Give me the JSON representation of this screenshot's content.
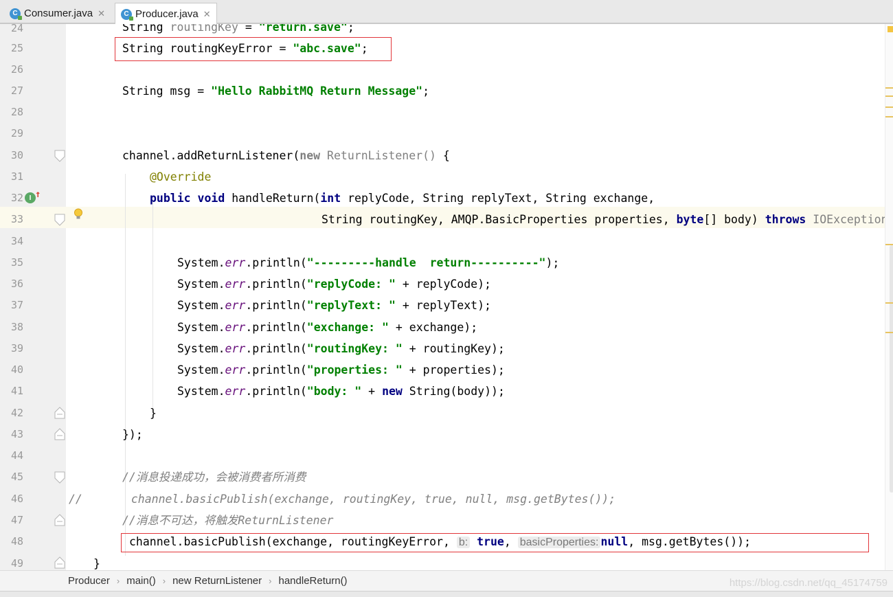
{
  "tabs": [
    {
      "label": "Consumer.java",
      "icon": "java-class-icon",
      "active": false
    },
    {
      "label": "Producer.java",
      "icon": "java-class-icon",
      "active": true
    }
  ],
  "line_numbers": [
    "24",
    "25",
    "26",
    "27",
    "28",
    "29",
    "30",
    "31",
    "32",
    "33",
    "34",
    "35",
    "36",
    "37",
    "38",
    "39",
    "40",
    "41",
    "42",
    "43",
    "44",
    "45",
    "46",
    "47",
    "48",
    "49"
  ],
  "code": {
    "l24": {
      "a": "String ",
      "b": "routingKey",
      "c": " = ",
      "d": "\"return.save\"",
      "e": ";"
    },
    "l25": {
      "a": "String routingKeyError = ",
      "b": "\"abc.save\"",
      "c": ";"
    },
    "l27": {
      "a": "String msg = ",
      "b": "\"Hello RabbitMQ Return Message\"",
      "c": ";"
    },
    "l30": {
      "a": "channel.addReturnListener(",
      "b": "new",
      "c": " ReturnListener() ",
      "d": "{"
    },
    "l31": {
      "a": "@Override"
    },
    "l32": {
      "a": "public",
      "b": " ",
      "c": "void",
      "d": " handleReturn(",
      "e": "int",
      "f": " replyCode, String replyText, String exchange,"
    },
    "l33": {
      "a": "String routingKey, AMQP.BasicProperties properties, ",
      "b": "byte",
      "c": "[] body) ",
      "d": "throws",
      "e": " IOException {"
    },
    "l35": {
      "a": "System.",
      "b": "err",
      "c": ".println(",
      "d": "\"---------handle  return----------\"",
      "e": ");"
    },
    "l36": {
      "a": "System.",
      "b": "err",
      "c": ".println(",
      "d": "\"replyCode: \"",
      "e": " + replyCode);"
    },
    "l37": {
      "a": "System.",
      "b": "err",
      "c": ".println(",
      "d": "\"replyText: \"",
      "e": " + replyText);"
    },
    "l38": {
      "a": "System.",
      "b": "err",
      "c": ".println(",
      "d": "\"exchange: \"",
      "e": " + exchange);"
    },
    "l39": {
      "a": "System.",
      "b": "err",
      "c": ".println(",
      "d": "\"routingKey: \"",
      "e": " + routingKey);"
    },
    "l40": {
      "a": "System.",
      "b": "err",
      "c": ".println(",
      "d": "\"properties: \"",
      "e": " + properties);"
    },
    "l41": {
      "a": "System.",
      "b": "err",
      "c": ".println(",
      "d": "\"body: \"",
      "e": " + ",
      "f": "new",
      "g": " String(body));"
    },
    "l42": {
      "a": "}"
    },
    "l43": {
      "a": "});"
    },
    "l45": {
      "a": "//消息投递成功，会被消费者所消费"
    },
    "l46": {
      "a": "//",
      "b": "channel.basicPublish(exchange, routingKey, true, null, msg.getBytes());"
    },
    "l47": {
      "a": "//消息不可达，将触发ReturnListener"
    },
    "l48": {
      "a": "channel.basicPublish(exchange, routingKeyError, ",
      "hint1": "b:",
      "b": "true",
      "c": ", ",
      "hint2": "basicProperties:",
      "d": "null",
      "e": ", msg.getBytes());"
    },
    "l49": {
      "a": "}"
    }
  },
  "gutter_icons": {
    "implements_badge": "I"
  },
  "breadcrumb": [
    "Producer",
    "main()",
    "new ReturnListener",
    "handleReturn()"
  ],
  "watermark": "https://blog.csdn.net/qq_45174759"
}
